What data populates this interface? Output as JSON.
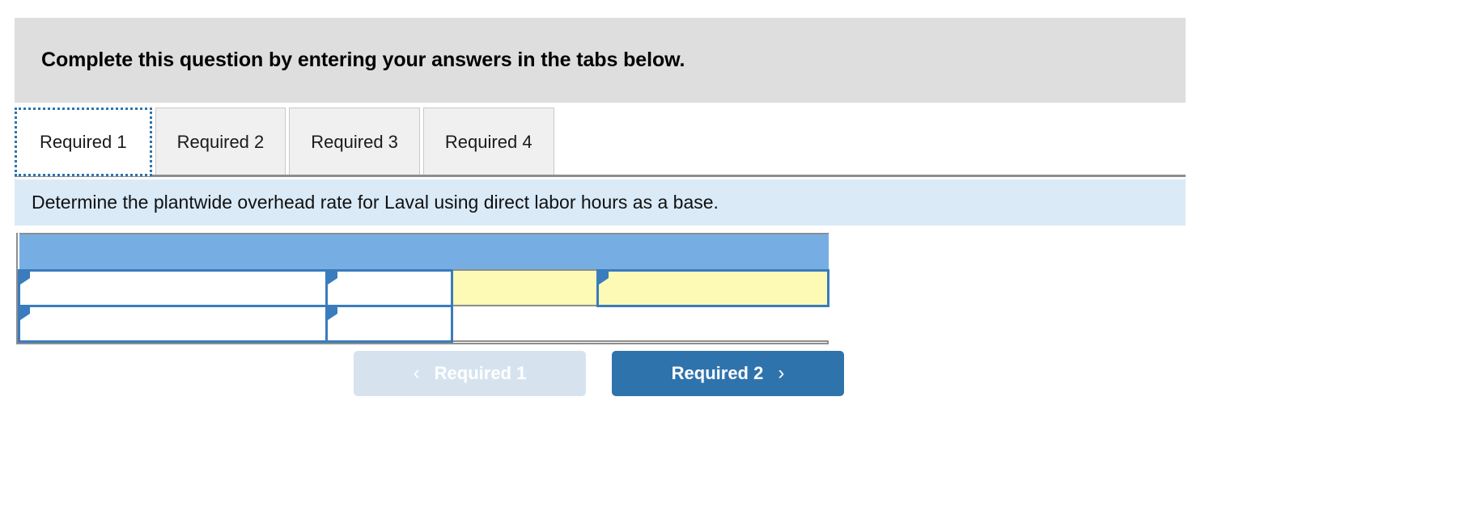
{
  "banner": {
    "text": "Complete this question by entering your answers in the tabs below."
  },
  "tabs": {
    "active_index": 0,
    "items": [
      {
        "label": "Required 1"
      },
      {
        "label": "Required 2"
      },
      {
        "label": "Required 3"
      },
      {
        "label": "Required 4"
      }
    ]
  },
  "instruction": {
    "text": "Determine the plantwide overhead rate for Laval using direct labor hours as a base."
  },
  "answer_table": {
    "header_row": {
      "cells": [
        "",
        "",
        "",
        ""
      ]
    },
    "rows": [
      {
        "cells": [
          {
            "kind": "editable",
            "value": "",
            "fill": "white"
          },
          {
            "kind": "editable",
            "value": "",
            "fill": "white"
          },
          {
            "kind": "readonly",
            "value": "",
            "fill": "yellow"
          },
          {
            "kind": "editable",
            "value": "",
            "fill": "yellow"
          }
        ]
      },
      {
        "cells": [
          {
            "kind": "editable",
            "value": "",
            "fill": "white"
          },
          {
            "kind": "editable",
            "value": "",
            "fill": "white"
          },
          {
            "kind": "plain",
            "value": "",
            "fill": "white",
            "colspan": 2
          }
        ]
      }
    ]
  },
  "nav": {
    "prev": {
      "label": "Required 1",
      "icon": "chevron-left-icon",
      "glyph": "‹",
      "disabled": true
    },
    "next": {
      "label": "Required 2",
      "icon": "chevron-right-icon",
      "glyph": "›",
      "disabled": false
    }
  },
  "colors": {
    "banner_bg": "#dedede",
    "instruction_bg": "#daeaf7",
    "table_header_bg": "#76aee4",
    "cell_editable_border": "#3a7cbd",
    "cell_yellow_bg": "#fcfab4",
    "btn_next_bg": "#2f73ad",
    "btn_prev_bg": "#d6e3ef",
    "tab_active_focus": "#2f73ad"
  }
}
